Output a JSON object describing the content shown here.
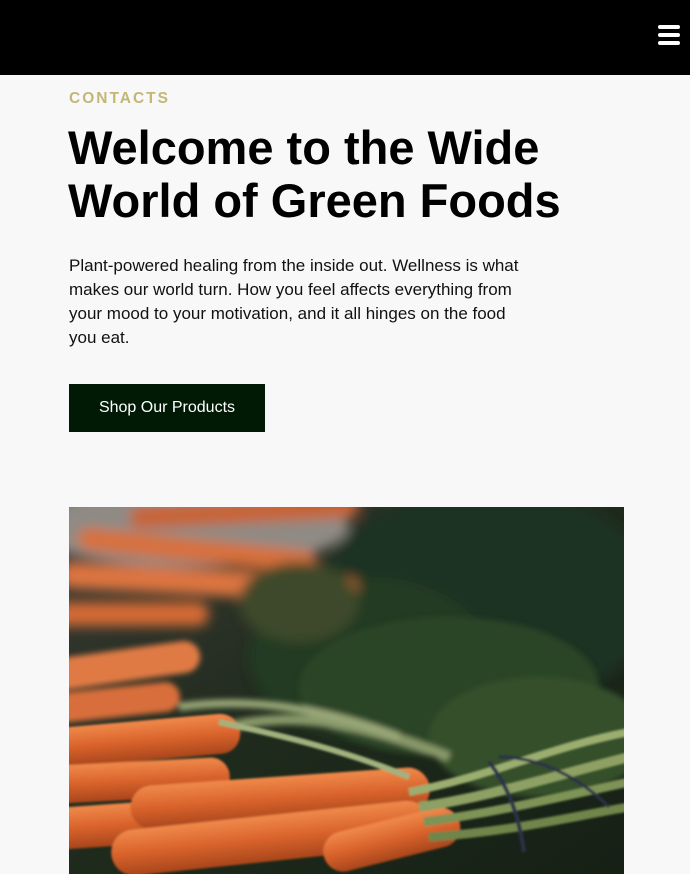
{
  "header": {
    "menu_icon": "hamburger-menu-icon",
    "background": "#000000"
  },
  "hero": {
    "eyebrow": "CONTACTS",
    "title": "Welcome to the Wide World of Green Foods",
    "intro": "Plant-powered healing from the inside out. Wellness is what makes our world turn. How you feel affects everything from your mood to your motivation, and it all hinges on the food you eat.",
    "cta_label": "Shop Our Products",
    "image_subject": "bunches of fresh carrots with green tops",
    "colors": {
      "eyebrow": "#c2b776",
      "cta_background": "#001a06",
      "page_background": "#f8f8f8"
    }
  }
}
